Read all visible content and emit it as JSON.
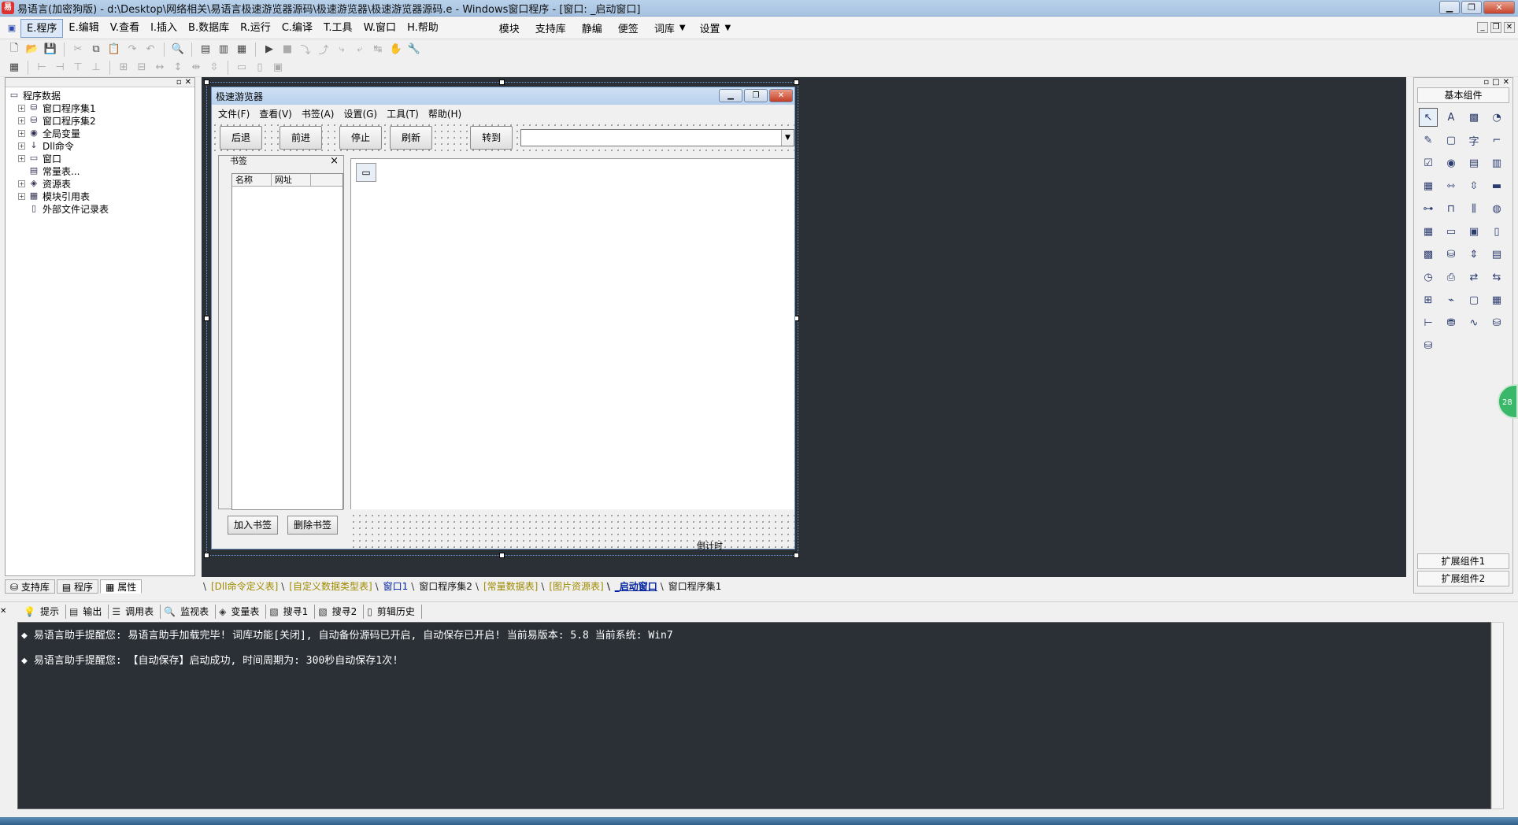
{
  "window": {
    "title": "易语言(加密狗版) - d:\\Desktop\\网络相关\\易语言极速游览器源码\\极速游览器\\极速游览器源码.e - Windows窗口程序 - [窗口: _启动窗口]"
  },
  "menubar": {
    "items": [
      "E.程序",
      "E.编辑",
      "V.查看",
      "I.插入",
      "B.数据库",
      "R.运行",
      "C.编译",
      "T.工具",
      "W.窗口",
      "H.帮助"
    ],
    "extras": [
      "模块",
      "支持库",
      "静编",
      "便签",
      "词库",
      "设置"
    ]
  },
  "left_panel": {
    "tree": [
      {
        "label": "程序数据",
        "level": 0
      },
      {
        "label": "窗口程序集1",
        "level": 1
      },
      {
        "label": "窗口程序集2",
        "level": 1
      },
      {
        "label": "全局变量",
        "level": 1
      },
      {
        "label": "Dll命令",
        "level": 1
      },
      {
        "label": "窗口",
        "level": 1
      },
      {
        "label": "常量表...",
        "level": 1
      },
      {
        "label": "资源表",
        "level": 1
      },
      {
        "label": "模块引用表",
        "level": 1
      },
      {
        "label": "外部文件记录表",
        "level": 1
      }
    ],
    "tabs": [
      "支持库",
      "程序",
      "属性"
    ]
  },
  "form": {
    "title": "极速游览器",
    "menu": [
      "文件(F)",
      "查看(V)",
      "书签(A)",
      "设置(G)",
      "工具(T)",
      "帮助(H)"
    ],
    "buttons": [
      "后退",
      "前进",
      "停止",
      "刷新",
      "转到"
    ],
    "url_value": "",
    "bookmark_panel": {
      "title": "书签",
      "columns": [
        "名称",
        "网址"
      ],
      "add_button": "加入书签",
      "delete_button": "删除书签"
    },
    "timer_label": "倒计时"
  },
  "design_tabs": [
    "[Dll命令定义表]",
    "[自定义数据类型表]",
    "窗口1",
    "窗口程序集2",
    "[常量数据表]",
    "[图片资源表]",
    "_启动窗口",
    "窗口程序集1"
  ],
  "design_tabs_active": "_启动窗口",
  "right_panel": {
    "title": "基本组件",
    "bottom_buttons": [
      "扩展组件1",
      "扩展组件2"
    ],
    "bubble": "28"
  },
  "output_tabs": [
    "提示",
    "输出",
    "调用表",
    "监视表",
    "变量表",
    "搜寻1",
    "搜寻2",
    "剪辑历史"
  ],
  "output_lines": [
    "易语言助手提醒您:  易语言助手加载完毕!  词库功能[关闭], 自动备份源码已开启, 自动保存已开启!  当前易版本: 5.8  当前系统: Win7",
    "易语言助手提醒您: 【自动保存】启动成功, 时间周期为: 300秒自动保存1次!"
  ],
  "colors": {
    "design_bg": "#2b3037",
    "output_bg": "#2b3037",
    "active_tab": "#0020a0",
    "bracket_tab": "#a08a00"
  }
}
